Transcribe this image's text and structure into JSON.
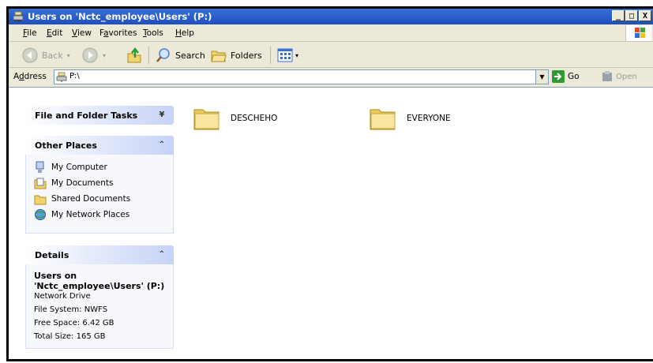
{
  "window": {
    "title": "Users on 'Nctc_employee\\Users' (P:)",
    "buttons": [
      "_",
      "□",
      "X"
    ]
  },
  "menu": {
    "items": [
      {
        "key": "F",
        "rest": "ile"
      },
      {
        "key": "E",
        "rest": "dit"
      },
      {
        "key": "V",
        "rest": "iew"
      },
      {
        "pre": "F",
        "key": "a",
        "rest": "vorites"
      },
      {
        "key": "T",
        "rest": "ools"
      },
      {
        "key": "H",
        "rest": "elp"
      }
    ]
  },
  "toolbar": {
    "back_label": "Back",
    "search_label": "Search",
    "folders_label": "Folders"
  },
  "address": {
    "label_pre": "A",
    "label_key": "d",
    "label_rest": "dress",
    "value": "P:\\",
    "go_label": "Go",
    "open_label": "Open"
  },
  "tasks": {
    "file_folder_title": "File and Folder Tasks",
    "other_places_title": "Other Places",
    "other_places": [
      {
        "label": "My Computer",
        "icon": "computer-icon"
      },
      {
        "label": "My Documents",
        "icon": "documents-icon"
      },
      {
        "label": "Shared Documents",
        "icon": "folder-icon"
      },
      {
        "label": "My Network Places",
        "icon": "network-icon"
      }
    ],
    "details_title": "Details",
    "details": {
      "name_line1": "Users on",
      "name_line2": "'Nctc_employee\\Users' (P:)",
      "type": "Network Drive",
      "file_system": "File System: NWFS",
      "free_space": "Free Space: 6.42 GB",
      "total_size": "Total Size: 165 GB"
    }
  },
  "folders": [
    {
      "name": "DESCHEHO"
    },
    {
      "name": "EVERYONE"
    }
  ],
  "colors": {
    "titlebar": "#1f4fbf",
    "panel_header": "#c6d3f7",
    "window_bg": "#ece9d8"
  }
}
